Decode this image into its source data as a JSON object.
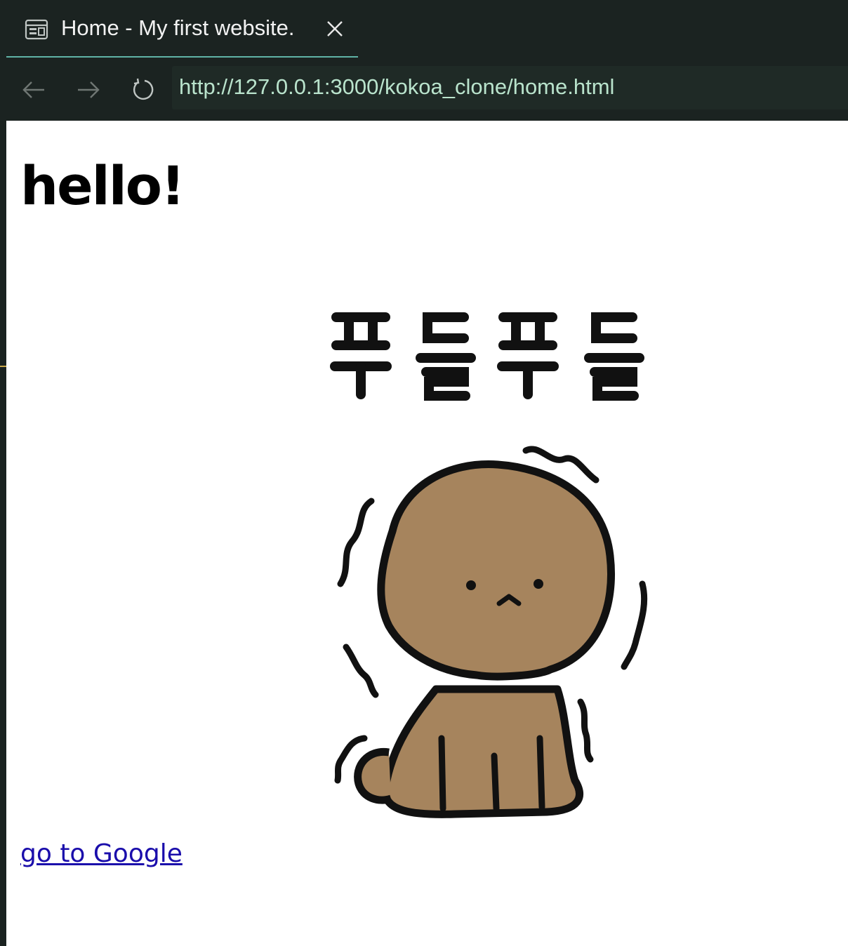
{
  "tab": {
    "title": "Home - My first website.",
    "icon": "page-layout-icon",
    "close_icon": "close-icon",
    "accent": "#5fb3a6"
  },
  "nav": {
    "back_icon": "arrow-left-icon",
    "forward_icon": "arrow-right-icon",
    "reload_icon": "reload-icon",
    "url": "http://127.0.0.1:3000/kokoa_clone/home.html",
    "url_color": "#b9e3cc"
  },
  "page": {
    "heading": "hello!",
    "sticker_text": "푸들푸들",
    "sticker_icon": "shivering-poodle-illustration",
    "link_text": "go to Google",
    "link_color": "#1a0dab"
  }
}
